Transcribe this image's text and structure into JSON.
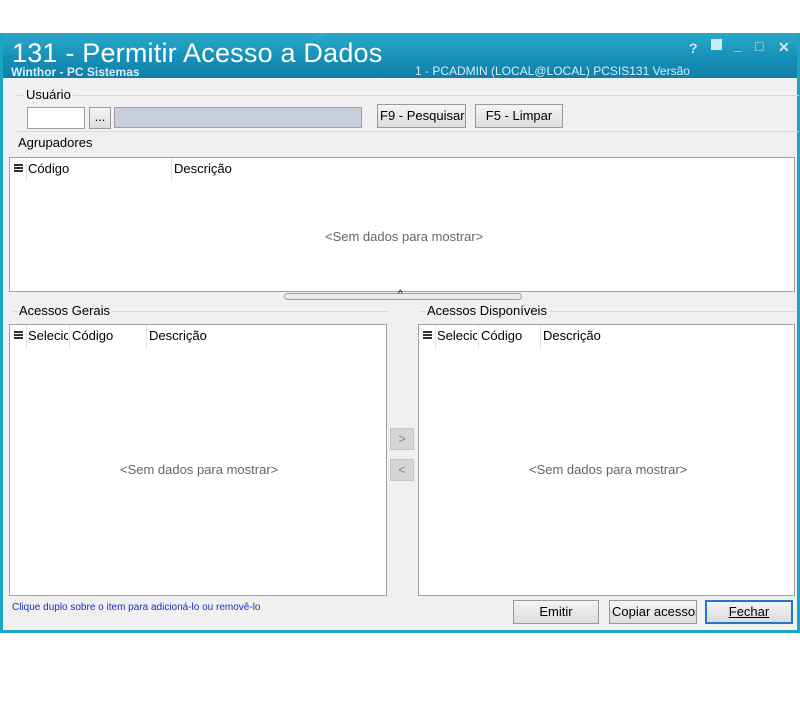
{
  "window": {
    "title": "131 - Permitir Acesso a Dados",
    "subtitle": "Winthor - PC Sistemas",
    "user_info": "1 - PCADMIN (LOCAL@LOCAL)  PCSIS131  Versão",
    "controls": {
      "help": "?",
      "minimize": "_",
      "maximize": "□",
      "close": "✕"
    }
  },
  "usuario": {
    "label": "Usuário",
    "code_value": "",
    "lookup_label": "...",
    "name_value": "",
    "search_button": "F9 - Pesquisar",
    "clear_button": "F5 - Limpar"
  },
  "agrupadores": {
    "label": "Agrupadores",
    "columns": [
      "Código",
      "Descrição"
    ],
    "empty_message": "<Sem dados para mostrar>"
  },
  "acessos_gerais": {
    "label": "Acessos Gerais",
    "columns": [
      "Selecic",
      "Código",
      "Descrição"
    ],
    "empty_message": "<Sem dados para mostrar>"
  },
  "acessos_disponiveis": {
    "label": "Acessos Disponíveis",
    "columns": [
      "Selecic",
      "Código",
      "Descrição"
    ],
    "empty_message": "<Sem dados para mostrar>"
  },
  "transfer": {
    "add": ">",
    "remove": "<"
  },
  "footer": {
    "hint": "Clique duplo sobre o item para adicioná-lo ou removê-lo",
    "emitir": "Emitir",
    "copiar": "Copiar acessos",
    "fechar": "Fechar"
  },
  "colors": {
    "titlebar": "#1a9bc2",
    "border": "#1aa6c2",
    "hint": "#1e2fc0"
  }
}
